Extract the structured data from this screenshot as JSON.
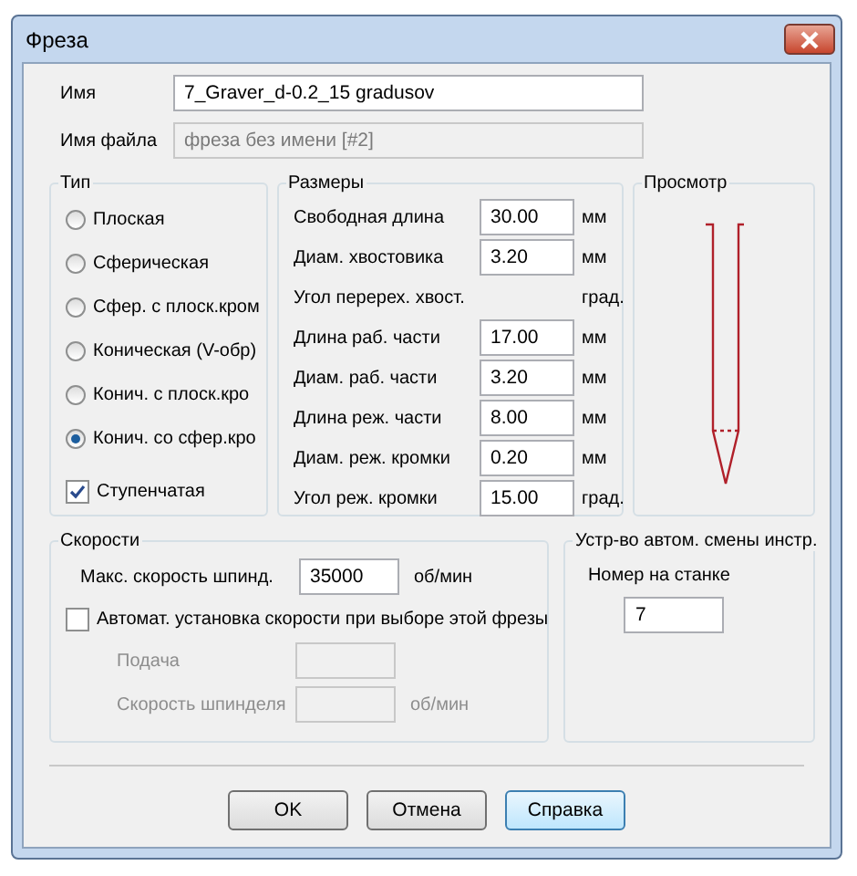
{
  "window": {
    "title": "Фреза"
  },
  "name_field": {
    "label": "Имя",
    "value": "7_Graver_d-0.2_15 gradusov",
    "disabled": false
  },
  "file_field": {
    "label": "Имя файла",
    "value": "фреза без имени [#2]",
    "disabled": true
  },
  "type_group": {
    "title": "Тип",
    "options": [
      {
        "label": "Плоская",
        "selected": false
      },
      {
        "label": "Сферическая",
        "selected": false
      },
      {
        "label": "Сфер. с плоск.кром",
        "selected": false
      },
      {
        "label": "Коническая (V-обр)",
        "selected": false
      },
      {
        "label": "Конич. с плоск.кро",
        "selected": false
      },
      {
        "label": "Конич. со сфер.кро",
        "selected": true
      }
    ],
    "stepped": {
      "label": "Ступенчатая",
      "checked": true
    }
  },
  "dimensions": {
    "title": "Размеры",
    "rows": [
      {
        "kind": "field",
        "label": "Свободная длина",
        "value": "30.00",
        "unit": "мм"
      },
      {
        "kind": "field",
        "label": "Диам. хвостовика",
        "value": "3.20",
        "unit": "мм"
      },
      {
        "kind": "text",
        "label": "Угол перерех. хвост.",
        "unit": "град."
      },
      {
        "kind": "field",
        "label": "Длина раб. части",
        "value": "17.00",
        "unit": "мм"
      },
      {
        "kind": "field",
        "label": "Диам. раб. части",
        "value": "3.20",
        "unit": "мм"
      },
      {
        "kind": "field",
        "label": "Длина реж. части",
        "value": "8.00",
        "unit": "мм"
      },
      {
        "kind": "field",
        "label": "Диам. реж. кромки",
        "value": "0.20",
        "unit": "мм"
      },
      {
        "kind": "field",
        "label": "Угол реж. кромки",
        "value": "15.00",
        "unit": "град."
      }
    ]
  },
  "preview": {
    "title": "Просмотр"
  },
  "speeds": {
    "title": "Скорости",
    "max_speed": {
      "label": "Макс. скорость шпинд.",
      "value": "35000",
      "unit": "об/мин"
    },
    "auto": {
      "label": "Автомат. установка скорости при выборе этой фрезы",
      "checked": false
    },
    "feed": {
      "label": "Подача",
      "disabled": true
    },
    "spindle": {
      "label": "Скорость шпинделя",
      "unit": "об/мин",
      "disabled": true
    }
  },
  "tool_changer": {
    "title": "Устр-во автом. смены инстр.",
    "number": {
      "label": "Номер на станке",
      "value": "7"
    }
  },
  "buttons": [
    {
      "label": "OK",
      "focused": false
    },
    {
      "label": "Отмена",
      "focused": false
    },
    {
      "label": "Справка",
      "focused": true
    }
  ]
}
